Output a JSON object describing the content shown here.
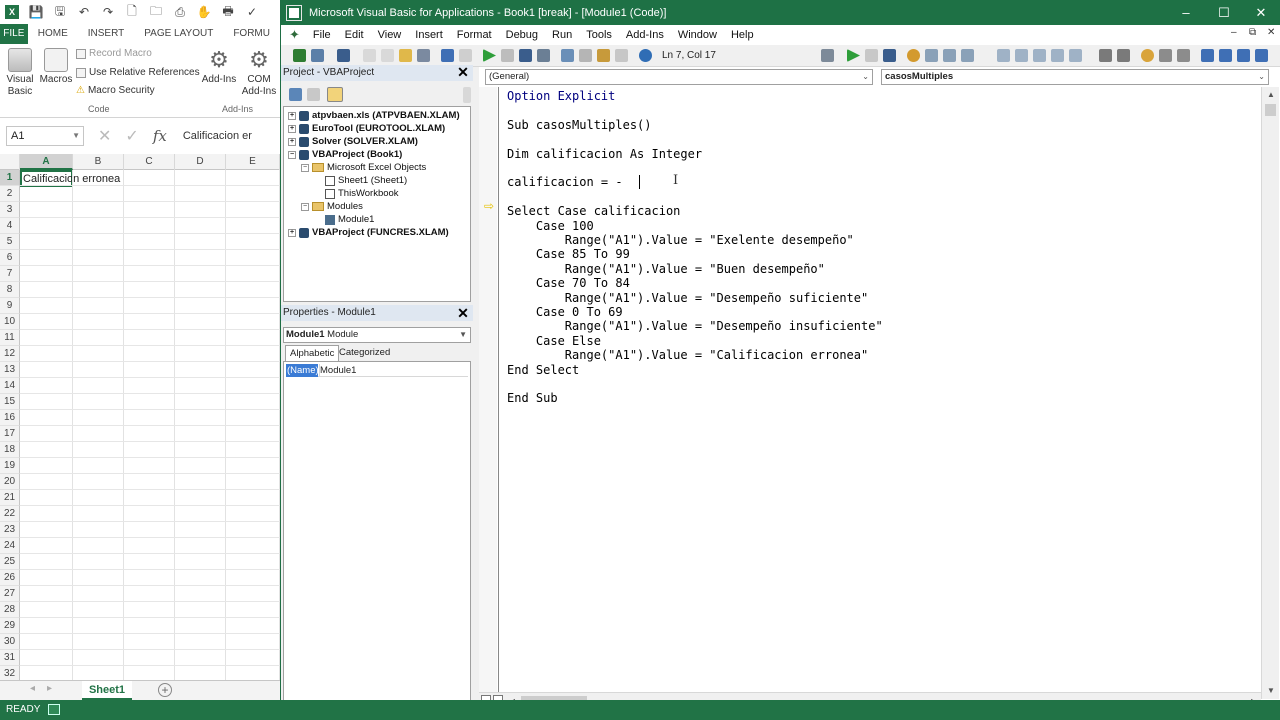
{
  "excel": {
    "logo_letter": "X",
    "ribbon_tabs": [
      "FILE",
      "HOME",
      "INSERT",
      "PAGE LAYOUT",
      "FORMU"
    ],
    "ribbon": {
      "visual_basic": "Visual Basic",
      "macros": "Macros",
      "record_macro": "Record Macro",
      "use_relative": "Use Relative References",
      "macro_security": "Macro Security",
      "addins": "Add-Ins",
      "com_addins": "COM Add-Ins",
      "group_code": "Code",
      "group_addins": "Add-Ins"
    },
    "name_box": "A1",
    "formula_bar_text": "Calificacion er",
    "fx_symbol": "fx",
    "columns": [
      "A",
      "B",
      "C",
      "D",
      "E"
    ],
    "rows": [
      "1",
      "2",
      "3",
      "4",
      "5",
      "6",
      "7",
      "8",
      "9",
      "10",
      "11",
      "12",
      "13",
      "14",
      "15",
      "16",
      "17",
      "18",
      "19",
      "20",
      "21",
      "22",
      "23",
      "24",
      "25",
      "26",
      "27",
      "28",
      "29",
      "30",
      "31",
      "32"
    ],
    "cell_a1": "Calificacion erronea",
    "sheet_tab": "Sheet1",
    "add_sheet": "+",
    "status": "READY"
  },
  "vbe": {
    "title": "Microsoft Visual Basic for Applications - Book1 [break] - [Module1 (Code)]",
    "window_controls": [
      "–",
      "☐",
      "✕"
    ],
    "menu": [
      "File",
      "Edit",
      "View",
      "Insert",
      "Format",
      "Debug",
      "Run",
      "Tools",
      "Add-Ins",
      "Window",
      "Help"
    ],
    "mdi_controls": [
      "–",
      "⧉",
      "✕"
    ],
    "cursor_position": "Ln 7, Col 17",
    "project_pane": {
      "title": "Project - VBAProject",
      "close": "✕",
      "tree": [
        {
          "label": "atpvbaen.xls (ATPVBAEN.XLAM)",
          "level": 0,
          "bold": true,
          "expander": "+",
          "icon": "vba"
        },
        {
          "label": "EuroTool (EUROTOOL.XLAM)",
          "level": 0,
          "bold": true,
          "expander": "+",
          "icon": "vba"
        },
        {
          "label": "Solver (SOLVER.XLAM)",
          "level": 0,
          "bold": true,
          "expander": "+",
          "icon": "vba"
        },
        {
          "label": "VBAProject (Book1)",
          "level": 0,
          "bold": true,
          "expander": "−",
          "icon": "vba"
        },
        {
          "label": "Microsoft Excel Objects",
          "level": 1,
          "bold": false,
          "expander": "−",
          "icon": "folder"
        },
        {
          "label": "Sheet1 (Sheet1)",
          "level": 2,
          "bold": false,
          "expander": "",
          "icon": "sheet"
        },
        {
          "label": "ThisWorkbook",
          "level": 2,
          "bold": false,
          "expander": "",
          "icon": "sheet"
        },
        {
          "label": "Modules",
          "level": 1,
          "bold": false,
          "expander": "−",
          "icon": "folder"
        },
        {
          "label": "Module1",
          "level": 2,
          "bold": false,
          "expander": "",
          "icon": "module"
        },
        {
          "label": "VBAProject (FUNCRES.XLAM)",
          "level": 0,
          "bold": true,
          "expander": "+",
          "icon": "vba"
        }
      ]
    },
    "properties_pane": {
      "title": "Properties - Module1",
      "close": "✕",
      "object_name": "Module1",
      "object_type": "Module",
      "tabs": [
        "Alphabetic",
        "Categorized"
      ],
      "prop_name": "(Name)",
      "prop_value": "Module1"
    },
    "code": {
      "general_combo": "(General)",
      "proc_combo": "casosMultiples",
      "lines": [
        {
          "text": "Option Explicit",
          "kw": true
        },
        {
          "text": "",
          "kw": false
        },
        {
          "text": "Sub casosMultiples()",
          "kw": false
        },
        {
          "text": "",
          "kw": false
        },
        {
          "text": "Dim calificacion As Integer",
          "kw": false
        },
        {
          "text": "",
          "kw": false
        },
        {
          "text": "calificacion = -",
          "kw": false
        },
        {
          "text": "",
          "kw": false
        },
        {
          "text": "Select Case calificacion",
          "kw": false
        },
        {
          "text": "    Case 100",
          "kw": false
        },
        {
          "text": "        Range(\"A1\").Value = \"Exelente desempeño\"",
          "kw": false
        },
        {
          "text": "    Case 85 To 99",
          "kw": false
        },
        {
          "text": "        Range(\"A1\").Value = \"Buen desempeño\"",
          "kw": false
        },
        {
          "text": "    Case 70 To 84",
          "kw": false
        },
        {
          "text": "        Range(\"A1\").Value = \"Desempeño suficiente\"",
          "kw": false
        },
        {
          "text": "    Case 0 To 69",
          "kw": false
        },
        {
          "text": "        Range(\"A1\").Value = \"Desempeño insuficiente\"",
          "kw": false
        },
        {
          "text": "    Case Else",
          "kw": false
        },
        {
          "text": "        Range(\"A1\").Value = \"Calificacion erronea\"",
          "kw": false
        },
        {
          "text": "End Select",
          "kw": false
        },
        {
          "text": "",
          "kw": false
        },
        {
          "text": "End Sub",
          "kw": false
        }
      ]
    }
  },
  "colors": {
    "excel_green": "#217346",
    "vbe_title": "#1e7145",
    "keyword_blue": "#00007f",
    "exec_arrow": "#e6c200"
  }
}
